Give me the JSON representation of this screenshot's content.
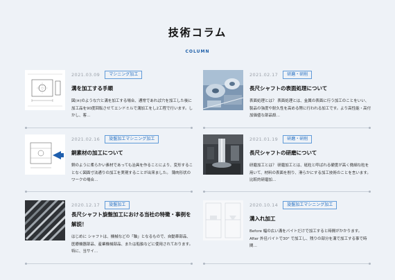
{
  "header": {
    "title": "技術コラム",
    "subtitle": "COLUMN"
  },
  "articles": [
    {
      "date": "2021.03.09",
      "tag": "マシニング加工",
      "title": "溝を加工する手順",
      "excerpt": "図(※)のような穴と溝を加工する場合、通常であれば穴を加工した後に加工品を90度回転させてエンドミルで溝加工をし2工程で行います。しかし、客…",
      "thumb_icon": "technical-drawing-image"
    },
    {
      "date": "2021.02.17",
      "tag": "研磨・研削",
      "title": "長尺シャフトの表面処理について",
      "excerpt": "表面処理とは？ 表面処理とは、金属の表面に行う加工のことをいい、製品の強度や耐久性を高める際に行われる加工です。より高性能・高付加価値な部品設…",
      "thumb_icon": "metal-parts-photo"
    },
    {
      "date": "2021.02.16",
      "tag": "旋盤加工マシニング加工",
      "title": "銅素材の加工について",
      "excerpt": "銅のように柔らかい素材であっても治具を作ることにより、変形することなく図面寸法通りの加工を実現することが出来ました。 薄肉形状のワークの場合…",
      "thumb_icon": "copper-part-drawing"
    },
    {
      "date": "2021.01.19",
      "tag": "研磨・研削",
      "title": "長尺シャフトの研磨について",
      "excerpt": "研磨加工とは？ 研磨加工とは、砥粒と呼ばれる硬度が高く微細な粒を用いて、材料の表面を削り、滑らかにする加工技術のことを言います。比較的研磨加…",
      "thumb_icon": "grinding-machine-photo"
    },
    {
      "date": "2020.12.17",
      "tag": "旋盤加工",
      "title": "長尺シャフト旋盤加工における当社の特徴・事例を解説！",
      "excerpt": "はじめに シャフトは、機械などの「軸」となるもので、自動車部品、医療機器部品、産業機械部品、または船舶などに使用されております。特に、当サイ…",
      "thumb_icon": "long-shafts-photo"
    },
    {
      "date": "2020.10.14",
      "tag": "旋盤加工マシニング加工",
      "title": "溝入れ加工",
      "excerpt": "Before 幅の広い溝をバイトだけで加工すると時間がかかります。 After 外径バイトで30° で加工し、残りの部分を溝で加工する事で時間…",
      "thumb_icon": "groove-drawing-image"
    }
  ]
}
